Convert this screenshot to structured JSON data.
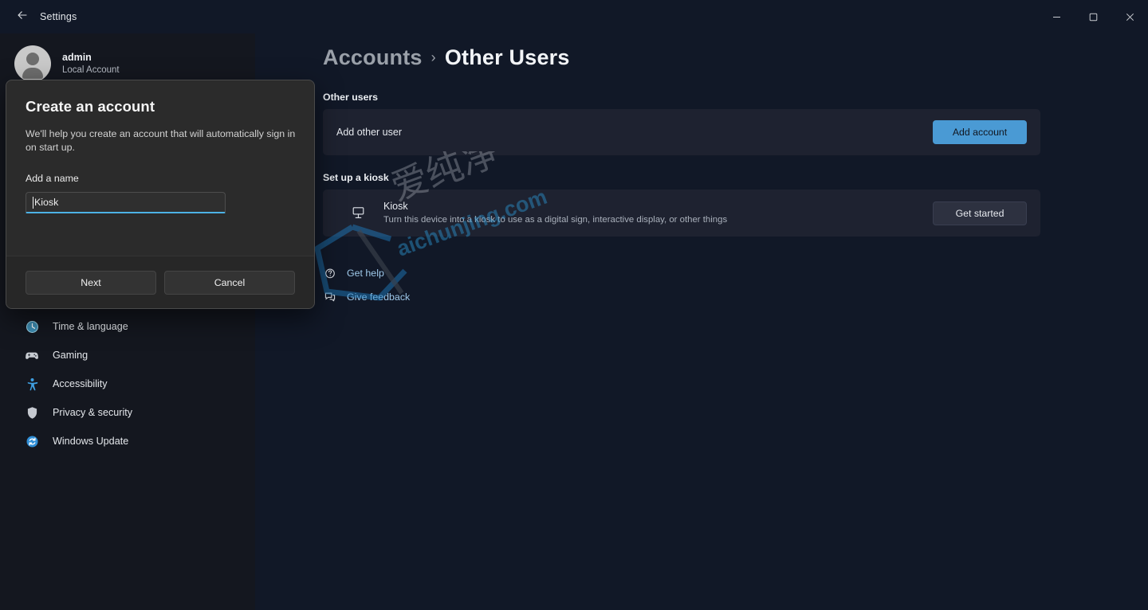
{
  "titlebar": {
    "back_icon": "arrow-left-icon",
    "title": "Settings",
    "minimize_label": "–",
    "maximize_label": "□",
    "close_label": "×"
  },
  "sidebar": {
    "account": {
      "name": "admin",
      "subtitle": "Local Account",
      "avatar_icon": "person-avatar-icon"
    },
    "items": [
      {
        "label": "Time & language",
        "icon": "clock-globe-icon",
        "color": "#4fa3c7"
      },
      {
        "label": "Gaming",
        "icon": "gamepad-icon",
        "color": "#c8ccd2"
      },
      {
        "label": "Accessibility",
        "icon": "accessibility-person-icon",
        "color": "#3f9fe0"
      },
      {
        "label": "Privacy & security",
        "icon": "shield-icon",
        "color": "#c8ccd2"
      },
      {
        "label": "Windows Update",
        "icon": "refresh-circle-icon",
        "color": "#2f8ed6"
      }
    ]
  },
  "main": {
    "breadcrumb": {
      "parent": "Accounts",
      "separator": "›",
      "current": "Other Users"
    },
    "sections": [
      {
        "label": "Other users",
        "row_label": "Add other user",
        "button_label": "Add account"
      },
      {
        "label": "Set up a kiosk",
        "icon": "monitor-kiosk-icon",
        "title": "Kiosk",
        "description": "Turn this device into a kiosk to use as a digital sign, interactive display, or other things",
        "button_label": "Get started"
      }
    ],
    "footer_links": [
      {
        "label": "Get help",
        "icon": "help-question-icon"
      },
      {
        "label": "Give feedback",
        "icon": "feedback-icon"
      }
    ]
  },
  "dialog": {
    "title": "Create an account",
    "description": "We'll help you create an account that will automatically sign in on start up.",
    "field_label": "Add a name",
    "input_value": "Kiosk",
    "input_placeholder": "",
    "primary_button": "Next",
    "secondary_button": "Cancel"
  },
  "watermark": {
    "chinese_text": "爱纯净",
    "domain_text": "aichunjing.com"
  },
  "colors": {
    "accent": "#4a9ad4",
    "background": "#111827",
    "sidebar": "#14171f",
    "card": "#1e2230",
    "dialog": "#2b2b2b",
    "link": "#9fc9ea",
    "focus_underline": "#4cb2e6"
  }
}
